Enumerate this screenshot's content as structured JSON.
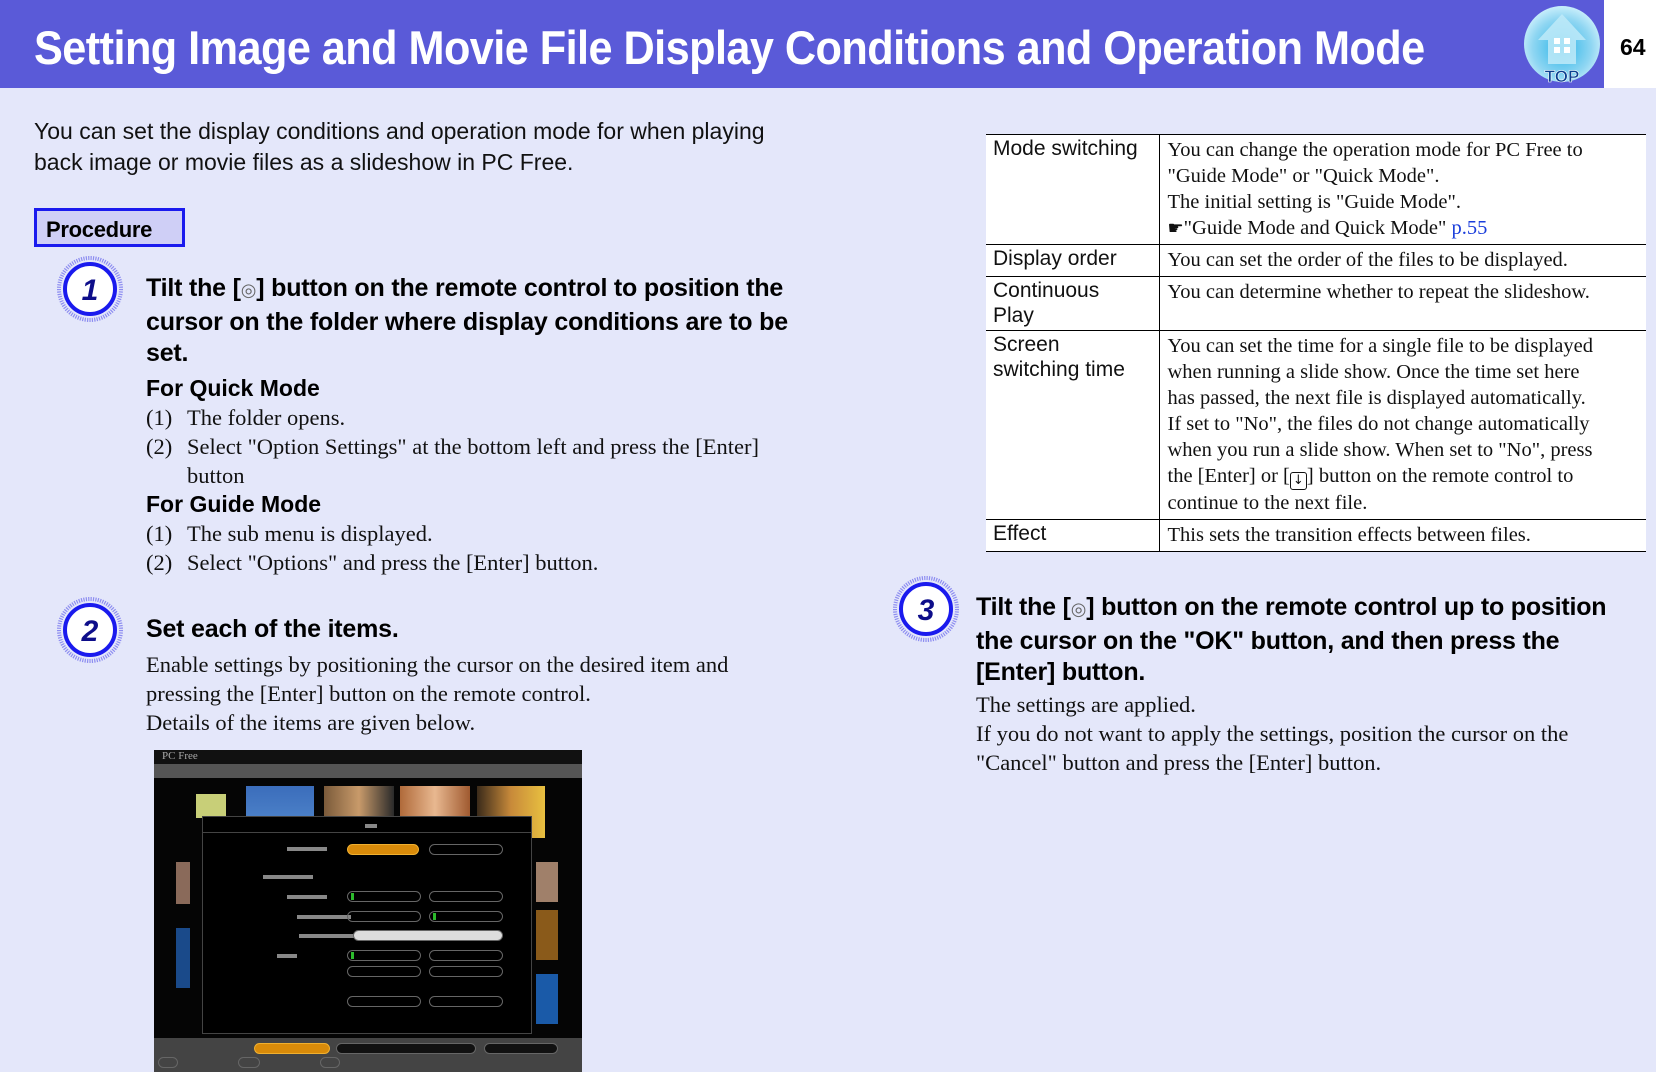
{
  "header": {
    "title": "Setting Image and Movie File Display Conditions and Operation Mode",
    "top_icon_label": "TOP",
    "page_number": "64",
    "colors": {
      "banner": "#5a5ad8",
      "page_background": "#e4e7fa",
      "step_circle": "#1a1aee",
      "link": "#1a3ddb"
    }
  },
  "intro": "You can set the display conditions and operation mode for when playing back image or movie files as a slideshow in PC Free.",
  "procedure_label": "Procedure",
  "steps": [
    {
      "number": "1",
      "heading_before": "Tilt the [",
      "heading_icon": "joystick-icon",
      "heading_after": "] button on the remote control to position the cursor on the folder where display conditions are to be set.",
      "sections": [
        {
          "title": "For Quick Mode",
          "items": [
            {
              "num": "(1)",
              "text": "The folder opens."
            },
            {
              "num": "(2)",
              "text": "Select \"Option Settings\" at the bottom left and press the [Enter] button"
            }
          ]
        },
        {
          "title": "For Guide Mode",
          "items": [
            {
              "num": "(1)",
              "text": "The sub menu is displayed."
            },
            {
              "num": "(2)",
              "text": "Select \"Options\" and press the [Enter] button."
            }
          ]
        }
      ]
    },
    {
      "number": "2",
      "heading": "Set each of the items.",
      "body_lines": [
        "Enable settings by positioning the cursor on the desired item and",
        "pressing the [Enter] button on the remote control.",
        "Details of the items are given below."
      ]
    },
    {
      "number": "3",
      "heading_before": "Tilt the [",
      "heading_icon": "joystick-icon",
      "heading_after": "] button on the remote control up to position the cursor on the \"OK\" button, and then press the [Enter] button.",
      "body_lines": [
        "The settings are applied.",
        "If you do not want to apply the settings, position the cursor on the",
        "\"Cancel\" button and press the [Enter] button."
      ]
    }
  ],
  "screenshot": {
    "app_title": "PC Free",
    "alt": "PC Free option settings dialog screen"
  },
  "settings_table": {
    "rows": [
      {
        "key": "Mode switching",
        "lines": [
          "You can change the operation mode for PC Free to",
          "\"Guide Mode\" or \"Quick Mode\".",
          "The initial setting is \"Guide Mode\"."
        ],
        "ref_text": "\"Guide Mode and Quick Mode\" ",
        "ref_link": "p.55"
      },
      {
        "key": "Display order",
        "lines": [
          "You can set the order of the files to be displayed."
        ]
      },
      {
        "key": "Continuous Play",
        "key_lines": [
          "Continuous",
          "Play"
        ],
        "lines": [
          "You can determine whether to repeat the slideshow."
        ]
      },
      {
        "key": "Screen switching time",
        "key_lines": [
          "Screen",
          "switching time"
        ],
        "lines": [
          "You can set the time for a single file to be displayed",
          "when running a slide show. Once the time set here",
          "has passed, the next file is displayed automatically.",
          "If set to \"No\", the files do not change automatically",
          "when you run a slide show. When set to \"No\", press"
        ],
        "line_before_key": "the [Enter] or [",
        "line_after_key": "] button on the remote control to",
        "last_line": "continue to the next file."
      },
      {
        "key": "Effect",
        "lines": [
          "This sets the transition effects between files."
        ]
      }
    ]
  }
}
